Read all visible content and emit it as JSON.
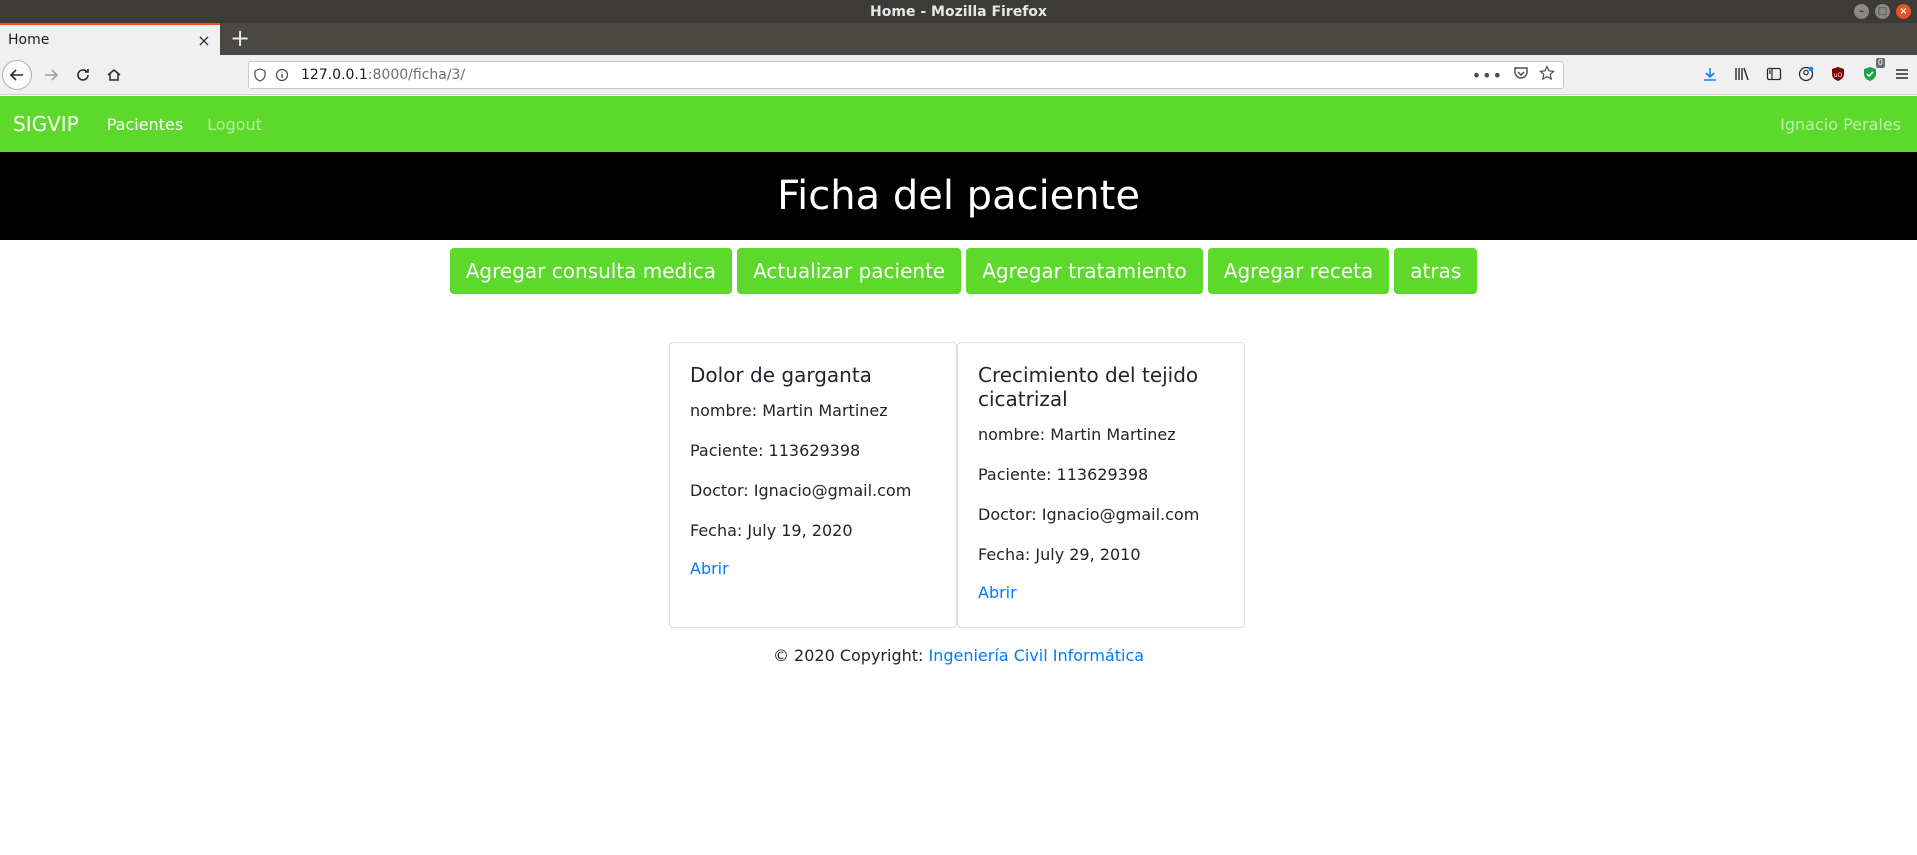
{
  "window": {
    "title": "Home - Mozilla Firefox"
  },
  "browser": {
    "tab_title": "Home",
    "url_host": "127.0.0.1",
    "url_rest": ":8000/ficha/3/",
    "badge_count": "0"
  },
  "site": {
    "brand": "SIGVIP",
    "nav": {
      "pacientes": "Pacientes",
      "logout": "Logout",
      "user": "Ignacio Perales"
    },
    "accent_color": "#5cd92a",
    "link_color": "#007bff"
  },
  "hero": {
    "title": "Ficha del paciente"
  },
  "actions": [
    "Agregar consulta medica",
    "Actualizar paciente",
    "Agregar tratamiento",
    "Agregar receta",
    "atras"
  ],
  "cards": [
    {
      "title": "Dolor de garganta",
      "nombre": "nombre: Martin Martinez",
      "paciente": "Paciente: 113629398",
      "doctor": "Doctor: Ignacio@gmail.com",
      "fecha": "Fecha: July 19, 2020",
      "link": "Abrir"
    },
    {
      "title": "Crecimiento del tejido cicatrizal",
      "nombre": "nombre: Martin Martinez",
      "paciente": "Paciente: 113629398",
      "doctor": "Doctor: Ignacio@gmail.com",
      "fecha": "Fecha: July 29, 2010",
      "link": "Abrir"
    }
  ],
  "footer": {
    "text": "© 2020 Copyright: ",
    "link": "Ingeniería Civil Informática"
  }
}
